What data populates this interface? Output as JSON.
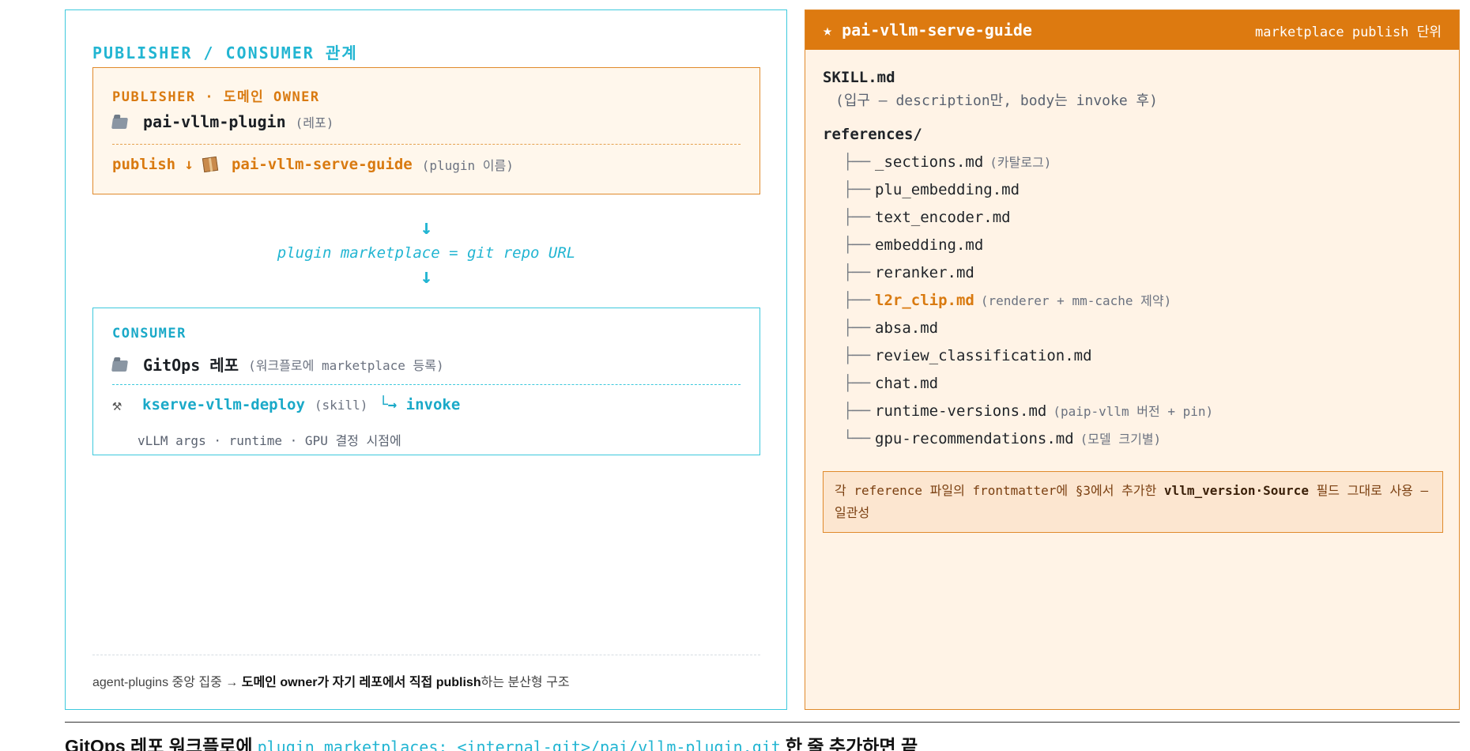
{
  "left": {
    "heading": "PUBLISHER / CONSUMER 관계",
    "publisher": {
      "title": "PUBLISHER · 도메인 OWNER",
      "repo_icon": "folder-icon",
      "repo_name": "pai-vllm-plugin",
      "repo_note": "(레포)",
      "publish_label": "publish ↓",
      "package_icon": "package-icon",
      "plugin_name": "pai-vllm-serve-guide",
      "plugin_note": "(plugin 이름)"
    },
    "flow": {
      "arrow_top": "↓",
      "label": "plugin marketplace = git repo URL",
      "arrow_bottom": "↓"
    },
    "consumer": {
      "title": "CONSUMER",
      "repo_icon": "folder-icon",
      "repo_name": "GitOps 레포",
      "repo_note": "(워크플로에 marketplace 등록)",
      "skill_icon": "tools-icon",
      "skill_name": "kserve-vllm-deploy",
      "skill_note": "(skill)",
      "invoke_label": "└→ invoke",
      "args_line": "vLLM args · runtime · GPU 결정 시점에"
    },
    "footer": {
      "prefix": "agent-plugins 중앙 집중 → ",
      "bold": "도메인 owner가 자기 레포에서 직접 publish",
      "suffix": "하는 분산형 구조"
    }
  },
  "right": {
    "title": "★ pai-vllm-serve-guide",
    "subtitle": "marketplace publish 단위",
    "skill_file": "SKILL.md",
    "skill_note": "(입구 — description만, body는 invoke 후)",
    "references_dir": "references/",
    "files": [
      {
        "branch": "├──",
        "name": "_sections.md",
        "note": "(카탈로그)"
      },
      {
        "branch": "├──",
        "name": "plu_embedding.md",
        "note": ""
      },
      {
        "branch": "├──",
        "name": "text_encoder.md",
        "note": ""
      },
      {
        "branch": "├──",
        "name": "embedding.md",
        "note": ""
      },
      {
        "branch": "├──",
        "name": "reranker.md",
        "note": ""
      },
      {
        "branch": "├──",
        "name": "l2r_clip.md",
        "note": "(renderer + mm-cache 제약)"
      },
      {
        "branch": "├──",
        "name": "absa.md",
        "note": ""
      },
      {
        "branch": "├──",
        "name": "review_classification.md",
        "note": ""
      },
      {
        "branch": "├──",
        "name": "chat.md",
        "note": ""
      },
      {
        "branch": "├──",
        "name": "runtime-versions.md",
        "note": "(paip-vllm 버전 + pin)"
      },
      {
        "branch": "└──",
        "name": "gpu-recommendations.md",
        "note": "(모델 크기별)"
      }
    ],
    "note_prefix": "각 reference 파일의 frontmatter에 §3에서 추가한 ",
    "note_bold": "vllm_version·Source",
    "note_suffix": " 필드 그대로 사용 — 일관성"
  },
  "bottom": {
    "prefix": "GitOps 레포 워크플로에",
    "code": "plugin_marketplaces: <internal-git>/pai/vllm-plugin.git",
    "suffix": "한 줄 추가하면 끝"
  },
  "colors": {
    "cyan": "#22b5d2",
    "orange": "#dd7a10",
    "right_bg": "#fff3e6"
  }
}
